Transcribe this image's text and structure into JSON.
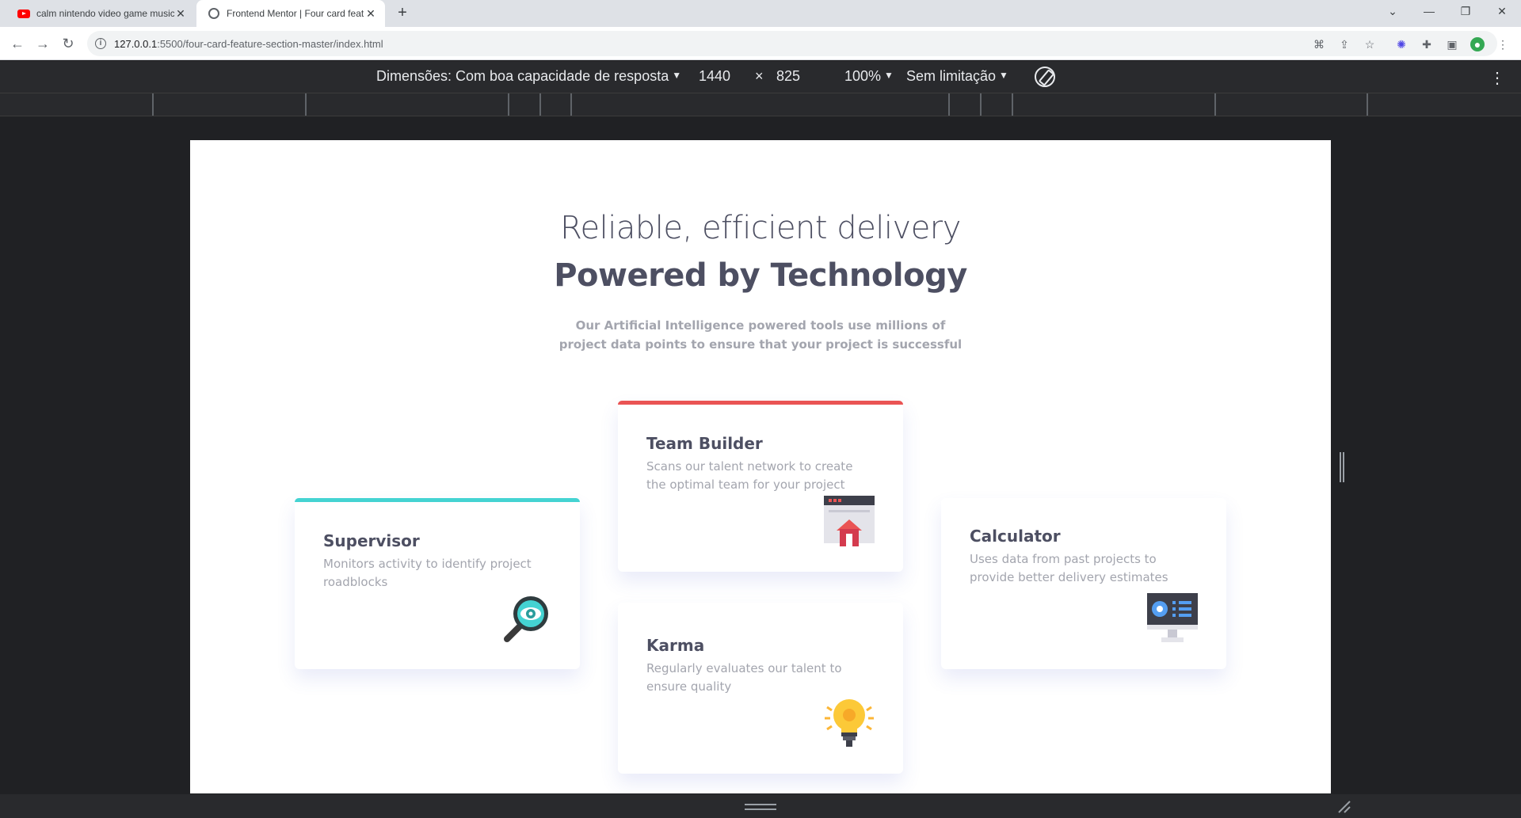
{
  "browser": {
    "tabs": [
      {
        "title": "calm nintendo video game music",
        "icon": "youtube-icon"
      },
      {
        "title": "Frontend Mentor | Four card feature section",
        "icon": "globe-icon"
      }
    ],
    "new_tab": "+",
    "url_host": "127.0.0.1",
    "url_rest": ":5500/four-card-feature-section-master/index.html"
  },
  "devtools": {
    "dimensions_label": "Dimensões: Com boa capacidade de resposta",
    "width": "1440",
    "times": "×",
    "height": "825",
    "zoom": "100%",
    "throttle": "Sem limitação"
  },
  "page": {
    "hero_light": "Reliable, efficient delivery",
    "hero_bold": "Powered by Technology",
    "hero_sub": "Our Artificial Intelligence powered tools use millions of project data points to ensure that your project is successful",
    "cards": [
      {
        "title": "Supervisor",
        "text": "Monitors activity to identify project roadblocks",
        "accent": "#44d3d2",
        "icon": "magnifier-eye-icon"
      },
      {
        "title": "Team Builder",
        "text": "Scans our talent network to create the optimal team for your project",
        "accent": "#ea5454",
        "icon": "team-builder-icon"
      },
      {
        "title": "Karma",
        "text": "Regularly evaluates our talent to ensure quality",
        "accent": "#fcaf4a",
        "icon": "lightbulb-icon"
      },
      {
        "title": "Calculator",
        "text": "Uses data from past projects to provide better delivery estimates",
        "accent": "#549ef2",
        "icon": "calculator-monitor-icon"
      }
    ]
  }
}
